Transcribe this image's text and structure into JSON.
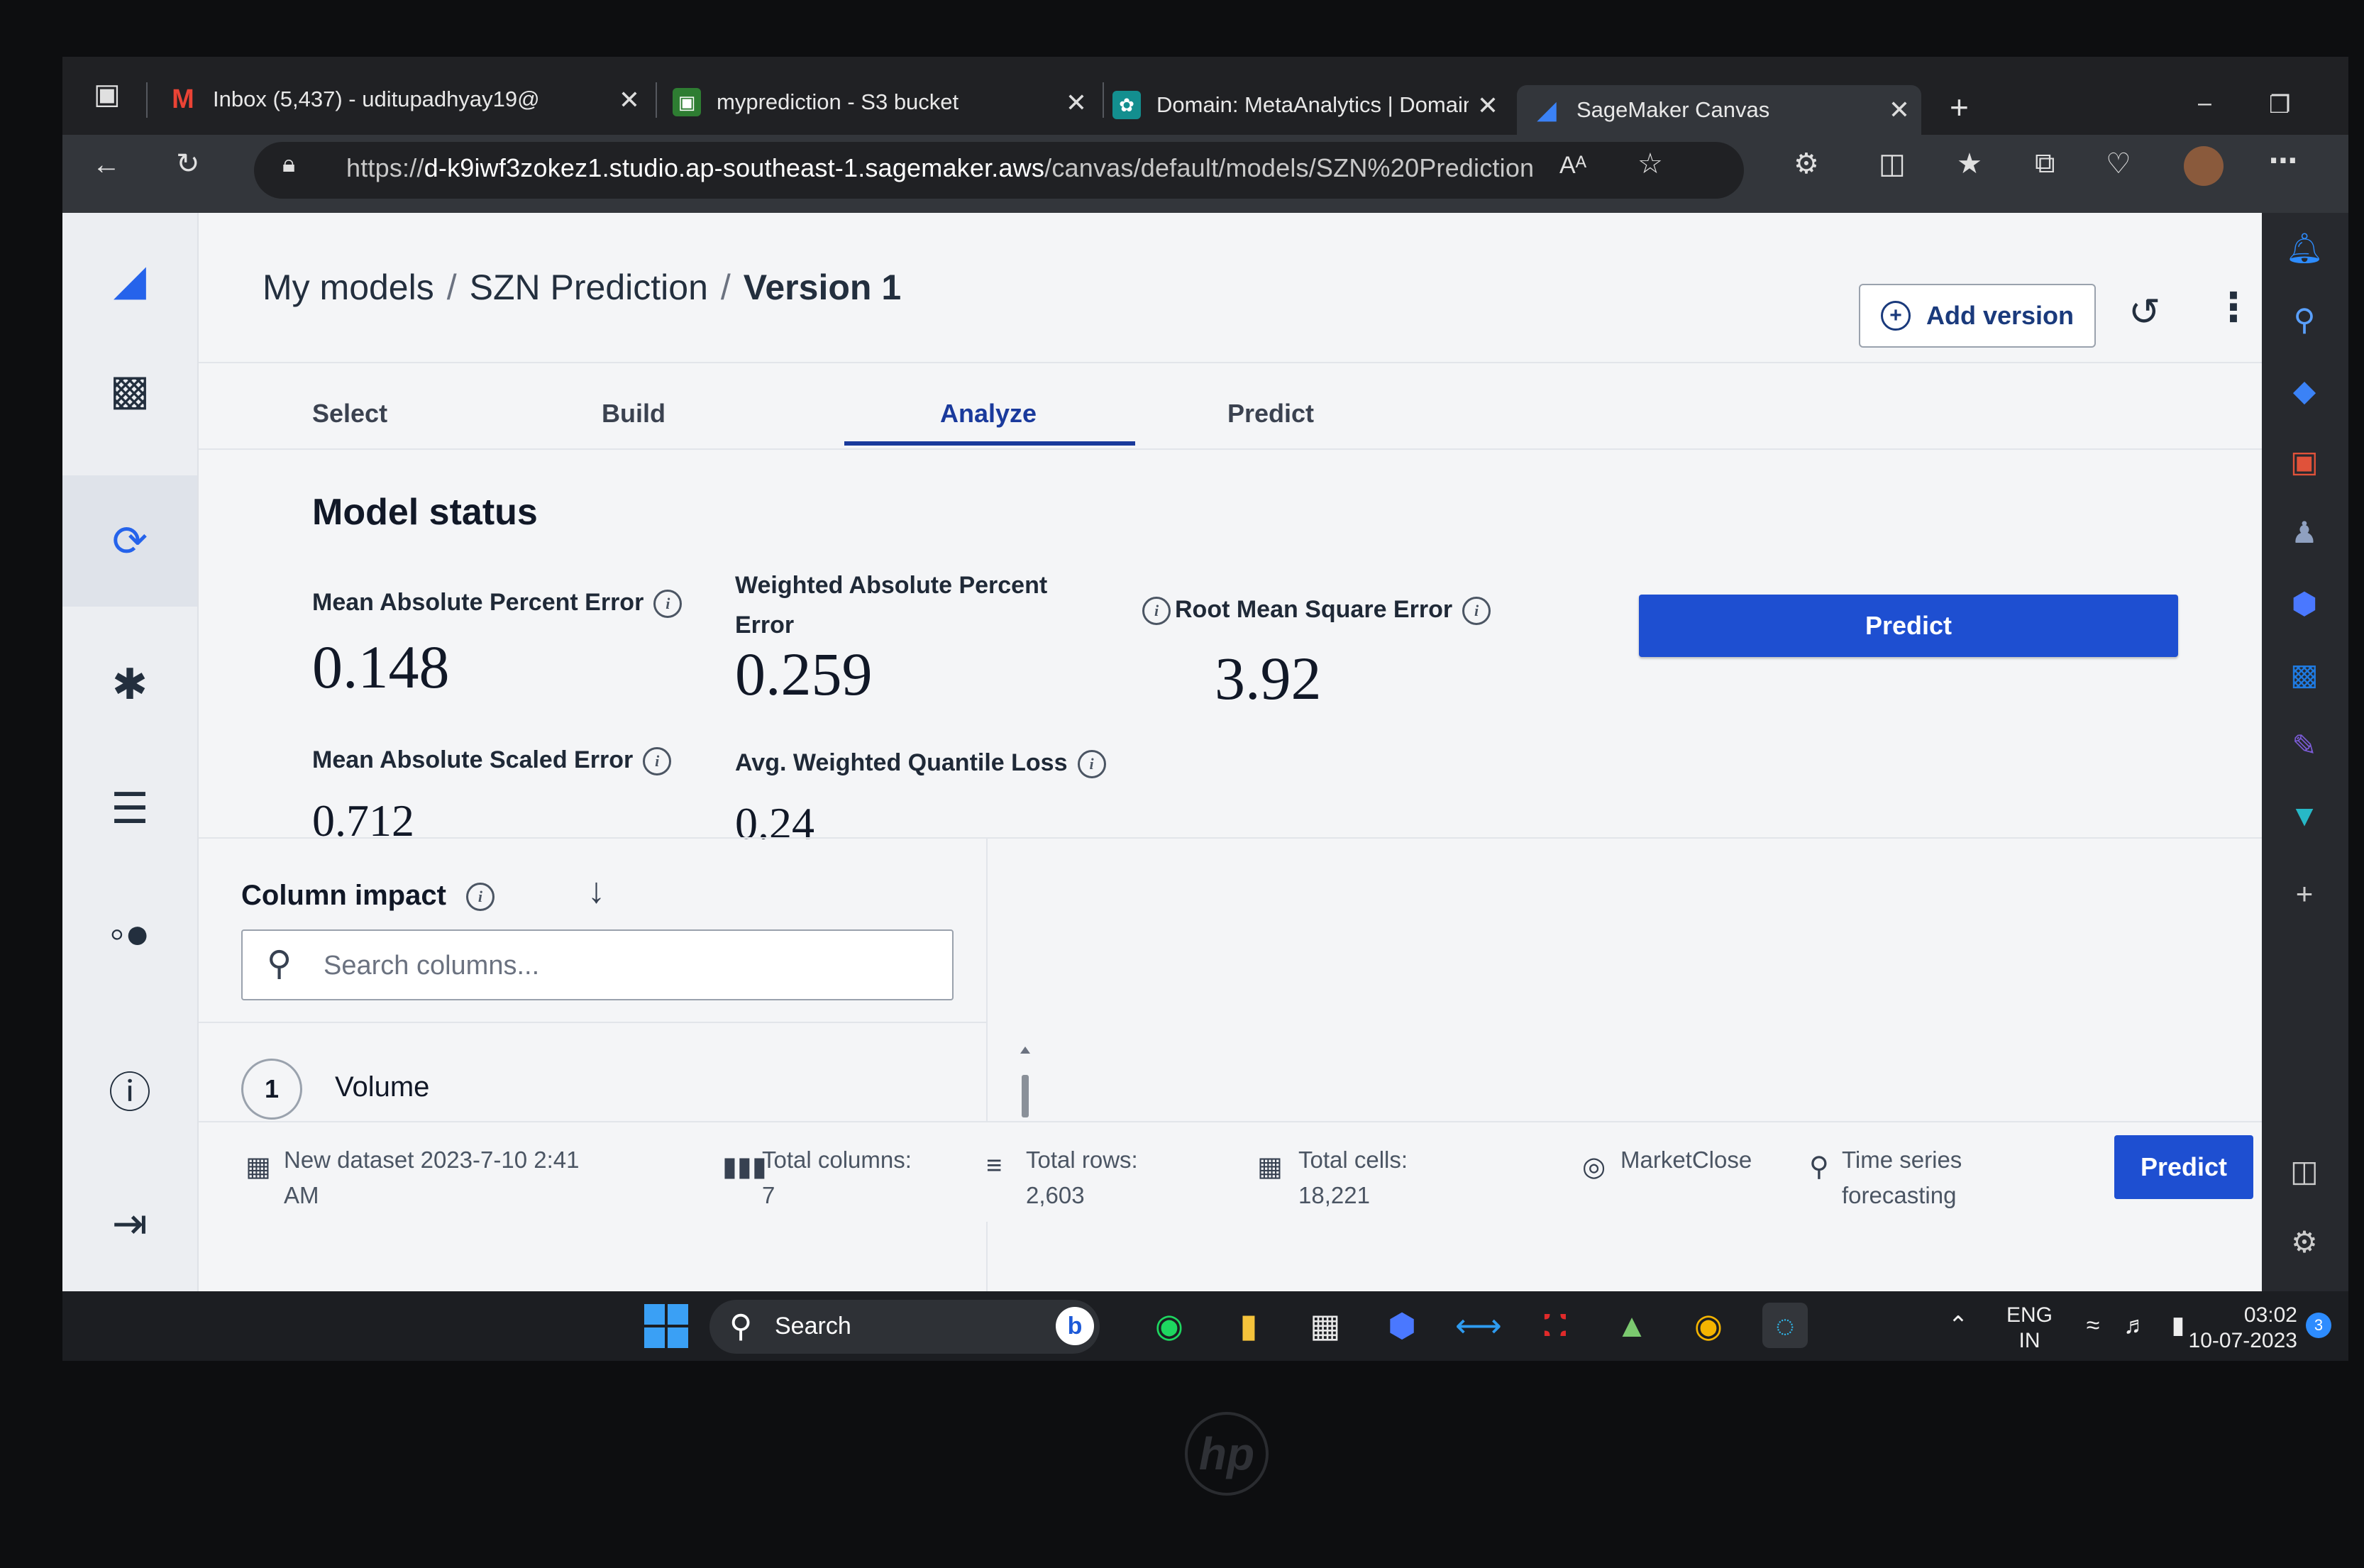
{
  "browser": {
    "tabs": [
      {
        "label": "Inbox (5,437) - uditupadhyay19@",
        "icon": "gmail-icon"
      },
      {
        "label": "myprediction - S3 bucket",
        "icon": "s3-icon"
      },
      {
        "label": "Domain: MetaAnalytics | Domain",
        "icon": "sagemaker-domain-icon"
      },
      {
        "label": "SageMaker Canvas",
        "icon": "sagemaker-canvas-icon"
      }
    ],
    "new_tab": "+",
    "url_prefix": "https://",
    "url_host": "d-k9iwf3zokez1.studio.ap-southeast-1.sagemaker.aws",
    "url_path": "/canvas/default/models/SZN%20Prediction",
    "read_aloud": "Aᴬ"
  },
  "breadcrumb": {
    "root": "My models",
    "model": "SZN Prediction",
    "version": "Version 1",
    "separator": "/"
  },
  "header": {
    "add_version": "Add version"
  },
  "tabs": {
    "select": "Select",
    "build": "Build",
    "analyze": "Analyze",
    "predict": "Predict",
    "active": "Analyze"
  },
  "model_status": {
    "title": "Model status",
    "mape_label": "Mean Absolute Percent Error",
    "mape_value": "0.148",
    "wape_label_1": "Weighted Absolute Percent",
    "wape_label_2": "Error",
    "wape_value": "0.259",
    "rmse_label": "Root Mean Square Error",
    "rmse_value": "3.92",
    "mase_label": "Mean Absolute Scaled Error",
    "mase_value": "0.712",
    "wql_label": "Avg. Weighted Quantile Loss",
    "wql_value": "0.24",
    "predict_button": "Predict"
  },
  "column_impact": {
    "title": "Column impact",
    "search_placeholder": "Search columns...",
    "rows": [
      {
        "rank": "1",
        "name": "Volume"
      }
    ]
  },
  "status_bar": {
    "dataset_1": "New dataset 2023-7-10 2:41",
    "dataset_2": "AM",
    "columns_label": "Total columns:",
    "columns_value": "7",
    "rows_label": "Total rows:",
    "rows_value": "2,603",
    "cells_label": "Total cells:",
    "cells_value": "18,221",
    "target": "MarketClose",
    "type_1": "Time series",
    "type_2": "forecasting",
    "predict_button": "Predict"
  },
  "taskbar": {
    "search": "Search",
    "lang_1": "ENG",
    "lang_2": "IN",
    "time": "03:02",
    "date": "10-07-2023",
    "notification_count": "3"
  },
  "brand": {
    "laptop_logo": "hp"
  },
  "colors": {
    "primary_blue": "#1e4fd1",
    "tab_active": "#1a3a9c",
    "text_dark": "#111827"
  }
}
